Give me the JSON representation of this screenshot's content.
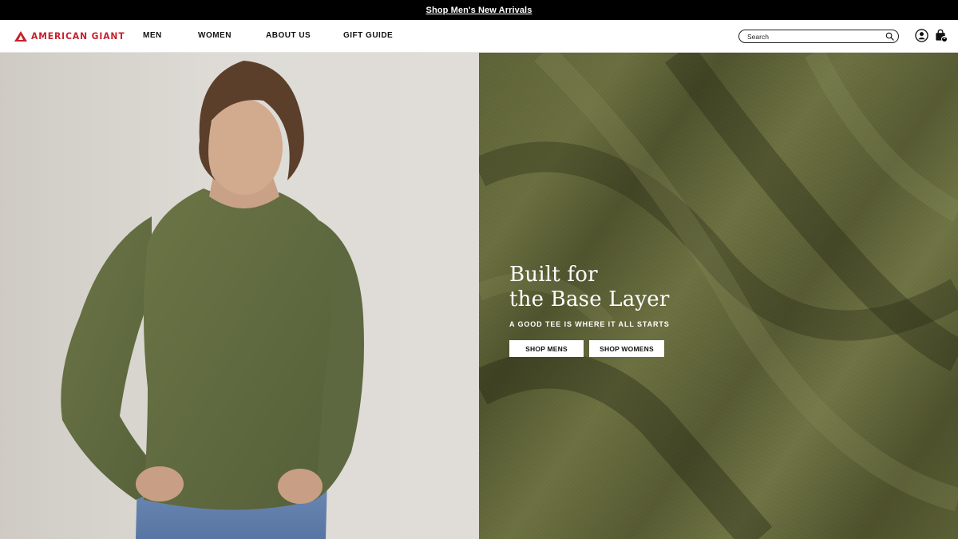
{
  "announcement": {
    "text": "Shop Men's New Arrivals"
  },
  "brand": {
    "name": "AMERICAN GIANT",
    "color": "#c8202d"
  },
  "nav": {
    "items": [
      {
        "label": "MEN"
      },
      {
        "label": "WOMEN"
      },
      {
        "label": "ABOUT US"
      },
      {
        "label": "GIFT GUIDE"
      }
    ]
  },
  "search": {
    "placeholder": "Search",
    "value": "",
    "icon": "search-icon"
  },
  "account": {
    "icon": "user-circle-icon"
  },
  "cart": {
    "icon": "shopping-bag-icon",
    "count": "0"
  },
  "hero": {
    "title_line1": "Built for",
    "title_line2": "the Base Layer",
    "subtitle": "A GOOD TEE IS WHERE IT ALL STARTS",
    "buttons": [
      {
        "label": "SHOP MENS"
      },
      {
        "label": "SHOP WOMENS"
      }
    ],
    "left_image": "man-in-olive-long-sleeve-tee",
    "right_image": "olive-fabric-closeup"
  },
  "colors": {
    "announcement_bg": "#000000",
    "fabric_olive": "#5f6437",
    "background_left": "#dcd9d4"
  }
}
